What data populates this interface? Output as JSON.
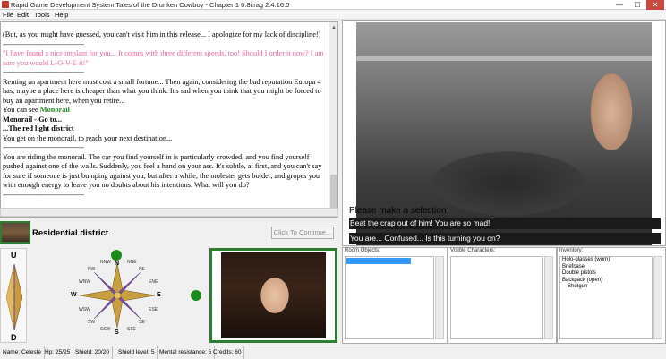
{
  "window": {
    "title": "Rapid Game Development System Tales of the Drunken Cowboy - Chapter 1 0.8i.rag 2.4.16.0",
    "min": "—",
    "max": "☐",
    "close": "✕"
  },
  "menu": [
    "File",
    "Edit",
    "Tools",
    "Help"
  ],
  "story": {
    "lines": [
      {
        "t": "(But, as you might have guessed, you can't visit him in this release... I apologize for my lack of discipline!)",
        "cls": ""
      },
      {
        "t": "----------------------------------------",
        "cls": "sep"
      },
      {
        "t": "\"I have found a nice implant for you... It comes with three different speeds, too! Should I order it now? I am sure you would L-O-V-E it!\"",
        "cls": "pink"
      },
      {
        "t": "----------------------------------------",
        "cls": "sep"
      },
      {
        "t": "Renting an apartment here must cost a small fortune... Then again, considering the bad reputation Europa 4 has, maybe a place here is cheaper than what you think. It's sad when you think that you might be forced to buy an apartment here, when you retire...",
        "cls": ""
      },
      {
        "t": "You can see ",
        "cls": "",
        "extra": "Monorail"
      },
      {
        "t": "Monorail - Go to...",
        "cls": "bold"
      },
      {
        "t": "...The red light district",
        "cls": "bold"
      },
      {
        "t": "You get on the monorail, to reach your next destination...",
        "cls": ""
      },
      {
        "t": "----------------------------------------",
        "cls": "sep"
      },
      {
        "t": "You are riding the monorail. The car you find yourself in is particularly crowded, and you find yourself pushed against one of the walls. Suddenly, you feel a hand on your ass. It's subtle, at first, and you can't say for sure if someone is just bumping against you, but after a while, the molester gets bolder, and gropes you with enough energy to leave you no doubts about his intentions. What will you do?",
        "cls": ""
      },
      {
        "t": "----------------------------------------",
        "cls": "sep"
      }
    ]
  },
  "location": {
    "name": "Residential district"
  },
  "continue_label": "Click To Continue...",
  "scene": {
    "prompt": "Please make a selection:",
    "options": [
      "Beat the crap out of him! You are so mad!",
      "You are... Confused... Is this turning you on?"
    ]
  },
  "compass": {
    "up": "U",
    "down": "D",
    "N": "N",
    "S": "S",
    "E": "E",
    "W": "W",
    "NE": "NE",
    "NW": "NW",
    "SE": "SE",
    "SW": "SW",
    "NNE": "NNE",
    "NNW": "NNW",
    "ENE": "ENE",
    "ESE": "ESE",
    "SSE": "SSE",
    "SSW": "SSW",
    "WNW": "WNW",
    "WSW": "WSW",
    "available_color": "#1b8a1b"
  },
  "panels": {
    "room_objects": {
      "title": "Room Objects:"
    },
    "visible_characters": {
      "title": "Visible Characters:"
    },
    "inventory": {
      "title": "Inventory:",
      "items": [
        {
          "label": "Holo-glasses (worn)",
          "sub": false
        },
        {
          "label": "Briefcase",
          "sub": false
        },
        {
          "label": "Double pistols",
          "sub": false
        },
        {
          "label": "Backpack (open)",
          "sub": false
        },
        {
          "label": "Shotgun",
          "sub": true
        }
      ]
    }
  },
  "status": {
    "name": "Name: Celeste",
    "hp": "Hp: 25/25",
    "shield": "Shield: 20/20",
    "shield_level": "Shield level: 5",
    "mental": "Mental resistance: 5",
    "credits": "Credits: 60"
  }
}
